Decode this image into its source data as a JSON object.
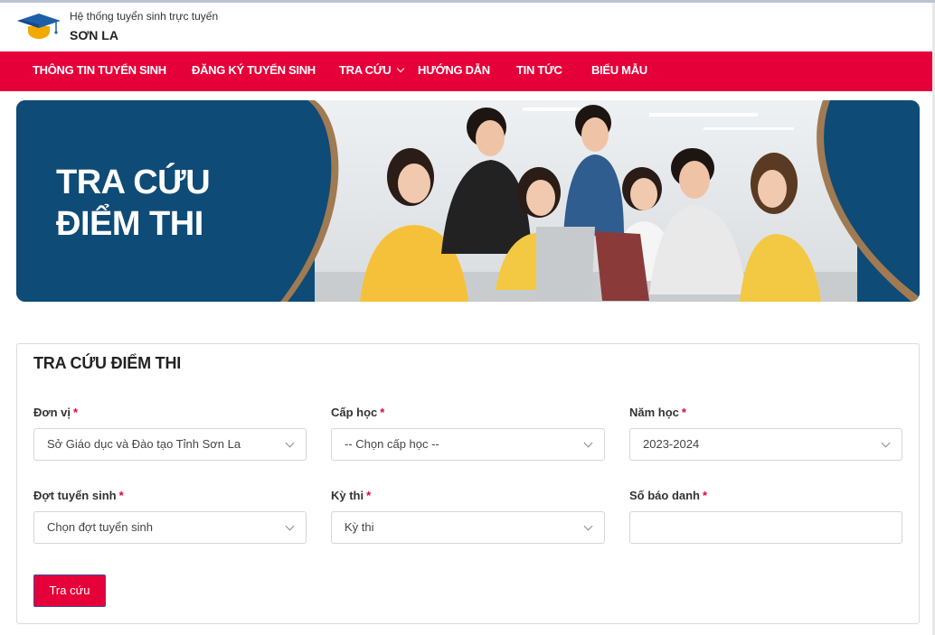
{
  "header": {
    "subtitle": "Hệ thống tuyển sinh trực tuyến",
    "title": "SƠN LA"
  },
  "nav": {
    "items": [
      {
        "label": "THÔNG TIN TUYỂN SINH"
      },
      {
        "label": "ĐĂNG KÝ TUYỂN SINH"
      },
      {
        "label": "TRA CỨU"
      },
      {
        "label": "HƯỚNG DẪN"
      },
      {
        "label": "TIN TỨC"
      },
      {
        "label": "BIỂU MẪU"
      }
    ]
  },
  "banner": {
    "line1": "TRA CỨU",
    "line2": "ĐIỂM THI"
  },
  "form": {
    "title": "TRA CỨU ĐIỂM THI",
    "don_vi": {
      "label": "Đơn vị",
      "value": "Sở Giáo dục và Đào tạo Tỉnh Sơn La"
    },
    "cap_hoc": {
      "label": "Cấp học",
      "value": "-- Chọn cấp học --"
    },
    "nam_hoc": {
      "label": "Năm học",
      "value": "2023-2024"
    },
    "dot_tuyen_sinh": {
      "label": "Đợt tuyển sinh",
      "value": "Chọn đợt tuyển sinh"
    },
    "ky_thi": {
      "label": "Kỳ thi",
      "value": "Kỳ thi"
    },
    "so_bao_danh": {
      "label": "Số báo danh",
      "value": ""
    },
    "required_mark": "*",
    "submit_label": "Tra cứu"
  },
  "colors": {
    "brand_red": "#e5003a",
    "banner_blue": "#0e4b77"
  }
}
